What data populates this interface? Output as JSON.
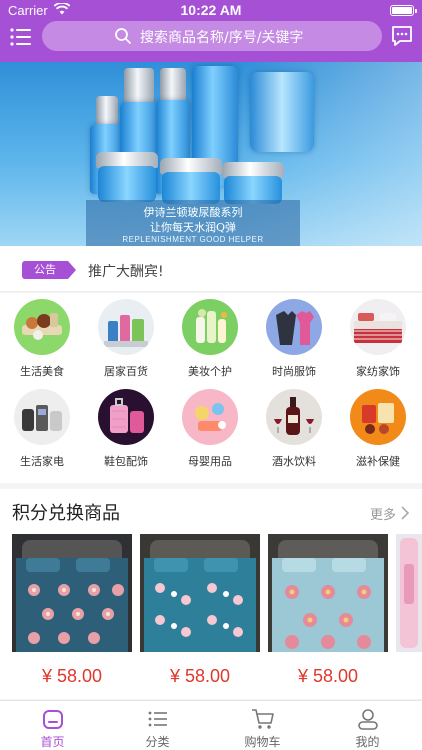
{
  "status_bar": {
    "carrier": "Carrier",
    "time": "10:22 AM"
  },
  "header": {
    "search_placeholder": "搜索商品名称/序号/关键字"
  },
  "banner": {
    "line1": "伊诗兰顿玻尿酸系列",
    "line2": "让你每天水润Q弹",
    "line3": "REPLENISHMENT GOOD HELPER"
  },
  "notice": {
    "tag": "公告",
    "text": "推广大酬宾!"
  },
  "categories": [
    {
      "label": "生活美食",
      "icon": "food-icon"
    },
    {
      "label": "居家百货",
      "icon": "household-icon"
    },
    {
      "label": "美妆个护",
      "icon": "cosmetics-icon"
    },
    {
      "label": "时尚服饰",
      "icon": "clothing-icon"
    },
    {
      "label": "家纺家饰",
      "icon": "bedding-icon"
    },
    {
      "label": "生活家电",
      "icon": "appliance-icon"
    },
    {
      "label": "鞋包配饰",
      "icon": "luggage-icon"
    },
    {
      "label": "母婴用品",
      "icon": "baby-icon"
    },
    {
      "label": "酒水饮料",
      "icon": "wine-icon"
    },
    {
      "label": "滋补保健",
      "icon": "health-icon"
    }
  ],
  "points_section": {
    "title": "积分兑换商品",
    "more": "更多",
    "products": [
      {
        "price": "¥ 58.00"
      },
      {
        "price": "¥ 58.00"
      },
      {
        "price": "¥ 58.00"
      }
    ]
  },
  "tabbar": {
    "tabs": [
      {
        "label": "首页",
        "icon": "home-icon",
        "active": true
      },
      {
        "label": "分类",
        "icon": "list-icon",
        "active": false
      },
      {
        "label": "购物车",
        "icon": "cart-icon",
        "active": false
      },
      {
        "label": "我的",
        "icon": "user-icon",
        "active": false
      }
    ]
  },
  "colors": {
    "brand": "#a650d6",
    "price": "#e0382c"
  }
}
